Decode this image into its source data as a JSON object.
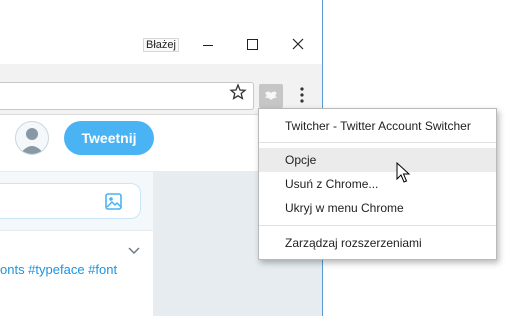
{
  "window": {
    "profile_name": "Błażej"
  },
  "toolbar": {
    "star_icon": "bookmark-star-icon",
    "extension_icon": "twitcher-extension-icon",
    "menu_icon": "chrome-menu-icon"
  },
  "twitter": {
    "tweet_button_label": "Tweetnij",
    "accent_color": "#4ab3f4",
    "hashtags_text": "onts #typeface #font"
  },
  "context_menu": {
    "items": [
      {
        "label": "Twitcher - Twitter Account Switcher"
      },
      {
        "label": "Opcje"
      },
      {
        "label": "Usuń z Chrome..."
      },
      {
        "label": "Ukryj w menu Chrome"
      },
      {
        "label": "Zarządzaj rozszerzeniami"
      }
    ]
  }
}
